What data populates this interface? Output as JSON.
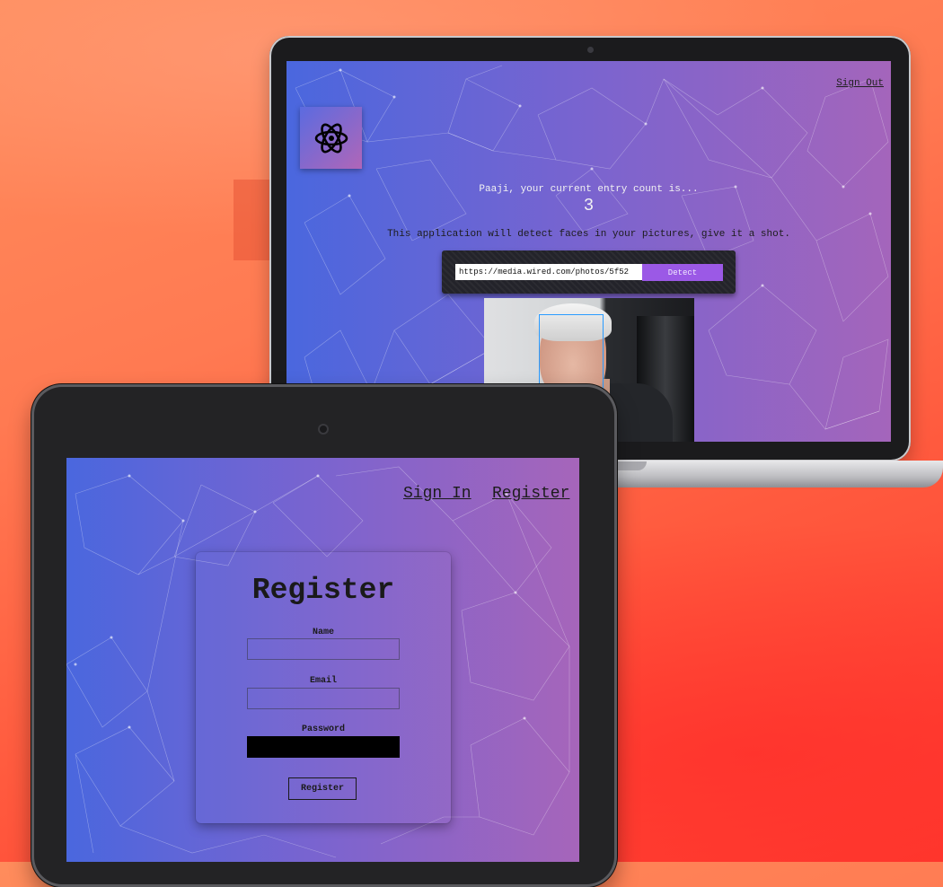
{
  "laptop": {
    "sign_out": "Sign Out",
    "logo_icon": "atom-icon",
    "entry_message": "Paaji, your current entry count is...",
    "entry_count": "3",
    "description": "This application will detect faces in your pictures, give it a shot.",
    "url_value": "https://media.wired.com/photos/5f52",
    "detect_label": "Detect",
    "accent": "#9b59e6",
    "bounding_box_color": "#2a9bff"
  },
  "tablet": {
    "nav": {
      "sign_in": "Sign In",
      "register": "Register"
    },
    "form": {
      "title": "Register",
      "name_label": "Name",
      "email_label": "Email",
      "password_label": "Password",
      "submit_label": "Register"
    }
  },
  "colors": {
    "gradient_start": "#4a67de",
    "gradient_end": "#a665ba",
    "background": "#ff6a48"
  }
}
